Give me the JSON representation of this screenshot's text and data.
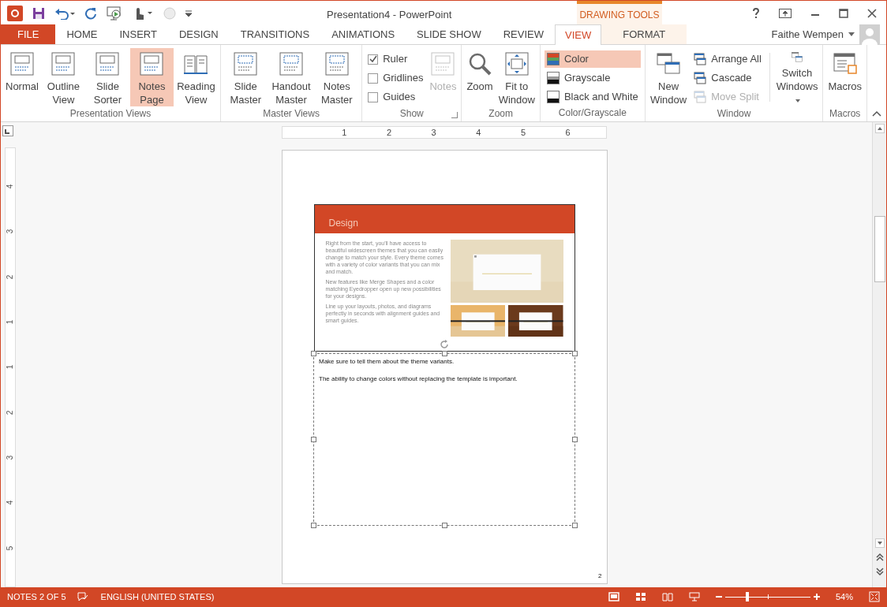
{
  "window": {
    "title": "Presentation4 - PowerPoint",
    "contextual_label": "DRAWING TOOLS"
  },
  "tabs": [
    {
      "label": "FILE",
      "kind": "file",
      "selected": false
    },
    {
      "label": "HOME",
      "kind": "tab",
      "selected": false
    },
    {
      "label": "INSERT",
      "kind": "tab",
      "selected": false
    },
    {
      "label": "DESIGN",
      "kind": "tab",
      "selected": false
    },
    {
      "label": "TRANSITIONS",
      "kind": "tab",
      "selected": false
    },
    {
      "label": "ANIMATIONS",
      "kind": "tab",
      "selected": false
    },
    {
      "label": "SLIDE SHOW",
      "kind": "tab",
      "selected": false
    },
    {
      "label": "REVIEW",
      "kind": "tab",
      "selected": false
    },
    {
      "label": "VIEW",
      "kind": "tab",
      "selected": true
    },
    {
      "label": "FORMAT",
      "kind": "contextual",
      "selected": false
    }
  ],
  "user": {
    "name": "Faithe Wempen"
  },
  "ribbon": [
    {
      "label": "Presentation Views",
      "items": [
        {
          "kind": "large",
          "label": "Normal",
          "selected": false
        },
        {
          "kind": "large",
          "label": "Outline View",
          "selected": false
        },
        {
          "kind": "large",
          "label": "Slide Sorter",
          "selected": false
        },
        {
          "kind": "large",
          "label": "Notes Page",
          "selected": true
        },
        {
          "kind": "large",
          "label": "Reading View",
          "selected": false
        }
      ]
    },
    {
      "label": "Master Views",
      "items": [
        {
          "kind": "large",
          "label": "Slide Master",
          "selected": false
        },
        {
          "kind": "large",
          "label": "Handout Master",
          "selected": false
        },
        {
          "kind": "large",
          "label": "Notes Master",
          "selected": false
        }
      ]
    },
    {
      "label": "Show",
      "launcher": true,
      "items": [
        {
          "kind": "check",
          "label": "Ruler",
          "checked": true
        },
        {
          "kind": "check",
          "label": "Gridlines",
          "checked": false
        },
        {
          "kind": "check",
          "label": "Guides",
          "checked": false
        },
        {
          "kind": "large",
          "label": "Notes",
          "selected": false,
          "disabled": true
        }
      ]
    },
    {
      "label": "Zoom",
      "items": [
        {
          "kind": "large",
          "label": "Zoom",
          "selected": false
        },
        {
          "kind": "large",
          "label": "Fit to Window",
          "selected": false
        }
      ]
    },
    {
      "label": "Color/Grayscale",
      "items": [
        {
          "kind": "small",
          "label": "Color",
          "selected": true
        },
        {
          "kind": "small",
          "label": "Grayscale",
          "selected": false
        },
        {
          "kind": "small",
          "label": "Black and White",
          "selected": false
        }
      ]
    },
    {
      "label": "Window",
      "items": [
        {
          "kind": "large",
          "label": "New Window",
          "selected": false
        },
        {
          "kind": "small",
          "label": "Arrange All",
          "selected": false
        },
        {
          "kind": "small",
          "label": "Cascade",
          "selected": false
        },
        {
          "kind": "small",
          "label": "Move Split",
          "selected": false,
          "disabled": true
        },
        {
          "kind": "large",
          "label": "Switch Windows",
          "selected": false,
          "dropdown": true
        }
      ]
    },
    {
      "label": "Macros",
      "items": [
        {
          "kind": "large",
          "label": "Macros",
          "selected": false
        }
      ]
    }
  ],
  "h_ruler": [
    "1",
    "2",
    "3",
    "4",
    "5",
    "6"
  ],
  "v_ruler": [
    "4",
    "3",
    "2",
    "1",
    "1",
    "2",
    "3",
    "4",
    "5"
  ],
  "notes_page": {
    "slide": {
      "title": "Design",
      "paragraphs": [
        "Right from the start, you'll have access to beautiful widescreen themes that you can easily change to match your style. Every theme comes with a variety of color variants that you can mix and match.",
        "New features like Merge Shapes and a color matching Eyedropper open up new possibilities for your designs.",
        "Line up your layouts, photos, and diagrams perfectly in seconds with alignment guides and smart guides."
      ]
    },
    "notes": [
      "Make sure to tell them about the theme variants.",
      "The ability to change colors without replacing the template is important."
    ],
    "page_number": "2"
  },
  "status_bar": {
    "slide_info": "NOTES 2 OF 5",
    "language": "ENGLISH (UNITED STATES)",
    "zoom": {
      "level": 0.26,
      "reading": "54%"
    }
  }
}
